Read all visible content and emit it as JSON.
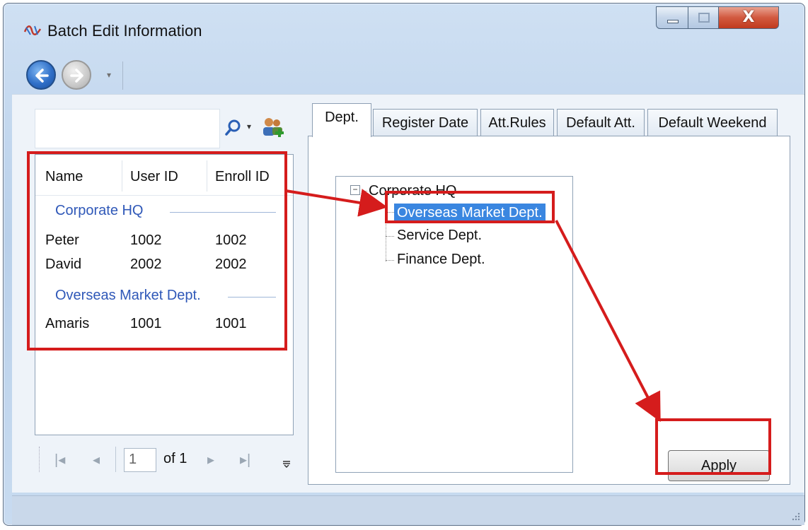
{
  "window": {
    "title": "Batch Edit Information",
    "controls": {
      "minimize": "–",
      "maximize": "□",
      "close": "X"
    }
  },
  "nav": {
    "back_icon": "back-arrow-icon",
    "forward_icon": "forward-arrow-icon",
    "dropdown": "▾"
  },
  "search": {
    "value": "",
    "search_icon": "magnifier-icon",
    "dropdown": "▾",
    "user_icon": "add-user-icon"
  },
  "user_list": {
    "columns": [
      "Name",
      "User ID",
      "Enroll ID"
    ],
    "groups": [
      {
        "label": "Corporate HQ",
        "rows": [
          {
            "name": "Peter",
            "user_id": "1002",
            "enroll_id": "1002"
          },
          {
            "name": "David",
            "user_id": "2002",
            "enroll_id": "2002"
          }
        ]
      },
      {
        "label": "Overseas Market Dept.",
        "rows": [
          {
            "name": "Amaris",
            "user_id": "1001",
            "enroll_id": "1001"
          }
        ]
      }
    ]
  },
  "pager": {
    "first": "|◂",
    "prev": "◂",
    "current_page": "1",
    "of_label": "of 1",
    "next": "▸",
    "last": "▸|"
  },
  "tabs": [
    {
      "label": "Dept.",
      "active": true
    },
    {
      "label": "Register Date",
      "active": false
    },
    {
      "label": "Att.Rules",
      "active": false
    },
    {
      "label": "Default Att.",
      "active": false
    },
    {
      "label": "Default Weekend",
      "active": false
    }
  ],
  "dept_tree": {
    "root": {
      "label": "Corporate HQ",
      "expander": "−"
    },
    "children": [
      {
        "label": "Overseas Market Dept.",
        "selected": true
      },
      {
        "label": "Service Dept.",
        "selected": false
      },
      {
        "label": "Finance Dept.",
        "selected": false
      }
    ]
  },
  "apply_button": {
    "label": "Apply"
  },
  "colors": {
    "selection": "#3a86e0",
    "group_label": "#2f58b8",
    "annotation": "#d51c1c"
  }
}
